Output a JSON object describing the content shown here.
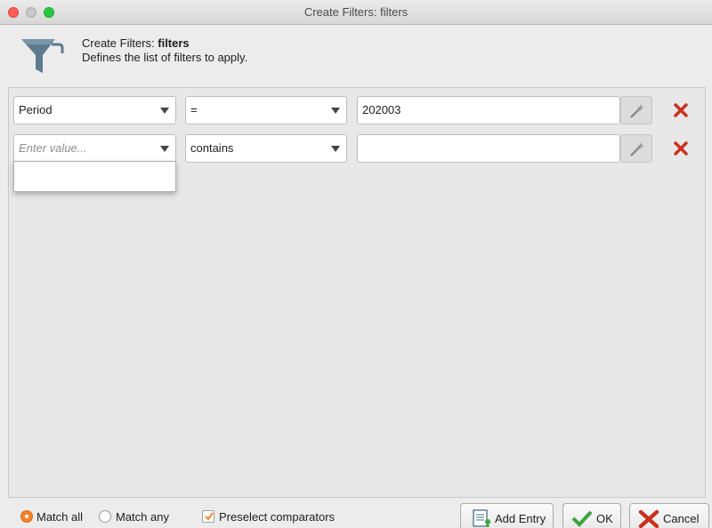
{
  "window": {
    "title": "Create Filters: filters"
  },
  "header": {
    "title_prefix": "Create Filters: ",
    "title_bold": "filters",
    "description": "Defines the list of filters to apply."
  },
  "rows": [
    {
      "column": "Period",
      "column_is_placeholder": false,
      "comparator": "=",
      "value": "202003"
    },
    {
      "column": "Enter value...",
      "column_is_placeholder": true,
      "comparator": "contains",
      "value": ""
    }
  ],
  "footer": {
    "match_all_label": "Match all",
    "match_any_label": "Match any",
    "match_selected": "all",
    "preselect_label": "Preselect comparators",
    "preselect_checked": true,
    "add_entry_label": "Add Entry",
    "ok_label": "OK",
    "cancel_label": "Cancel"
  },
  "colors": {
    "accent_orange": "#f5822a",
    "remove_red": "#c9321e",
    "ok_green": "#3da43d",
    "funnel_blue": "#5d7b8e"
  },
  "icons": [
    "filter-funnel-icon",
    "magic-wand-icon",
    "remove-x-icon",
    "add-entry-icon",
    "ok-check-icon",
    "cancel-x-icon",
    "checkmark-icon"
  ]
}
